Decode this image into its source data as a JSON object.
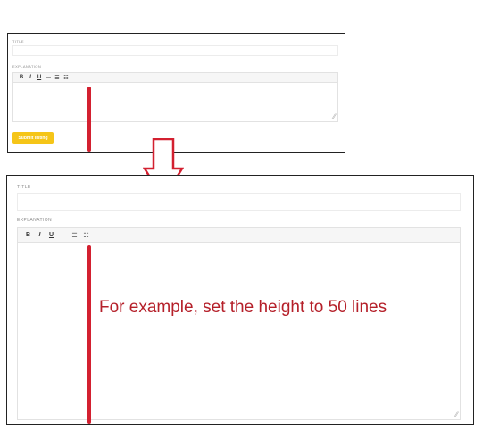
{
  "small_form": {
    "title_label": "TITLE",
    "explanation_label": "EXPLANATION",
    "toolbar": [
      {
        "label": "B",
        "name": "bold-button"
      },
      {
        "label": "I",
        "name": "italic-button"
      },
      {
        "label": "U",
        "name": "underline-button"
      },
      {
        "label": "—",
        "name": "horizontal-rule-button"
      },
      {
        "label": "☰",
        "name": "bullet-list-button"
      },
      {
        "label": "☷",
        "name": "numbered-list-button"
      }
    ],
    "submit_label": "Submit listing"
  },
  "large_form": {
    "title_label": "TITLE",
    "explanation_label": "EXPLANATION",
    "toolbar": [
      {
        "label": "B",
        "name": "bold-button"
      },
      {
        "label": "I",
        "name": "italic-button"
      },
      {
        "label": "U",
        "name": "underline-button"
      },
      {
        "label": "—",
        "name": "horizontal-rule-button"
      },
      {
        "label": "☰",
        "name": "bullet-list-button"
      },
      {
        "label": "☷",
        "name": "numbered-list-button"
      }
    ]
  },
  "annotation": "For example, set the height to 50 lines",
  "colors": {
    "accent": "#f5c518",
    "marker": "#d32030",
    "annotation_text": "#b5202a"
  }
}
